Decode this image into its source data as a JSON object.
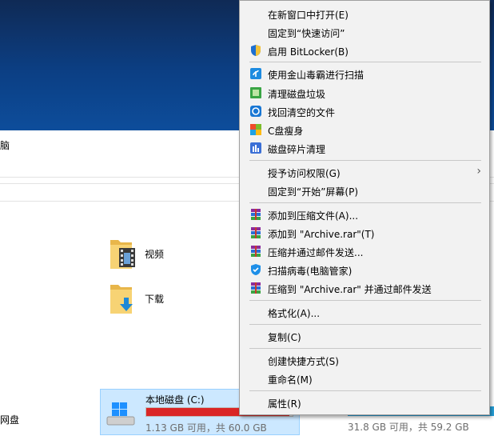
{
  "explorer": {
    "title_fragment": "脑",
    "folders": [
      {
        "label": "视频",
        "icon": "videos-folder-icon"
      },
      {
        "label": "下载",
        "icon": "downloads-folder-icon"
      }
    ],
    "drives": [
      {
        "name": "本地磁盘 (C:)",
        "free": "1.13 GB 可用，共 60.0 GB",
        "used_fraction": 0.98,
        "bar_color": "#da2626"
      },
      {
        "free": "31.8 GB 可用，共 59.2 GB",
        "bar_color": "#26a0da"
      }
    ],
    "netdisk_fragment": "网盘"
  },
  "menu": {
    "groups": [
      [
        {
          "label": "在新窗口中打开(E)"
        },
        {
          "label": "固定到“快速访问”"
        },
        {
          "label": "启用 BitLocker(B)",
          "icon": "shield-icon"
        }
      ],
      [
        {
          "label": "使用金山毒霸进行扫描",
          "icon": "kingsoft-antivirus-icon"
        },
        {
          "label": "清理磁盘垃圾",
          "icon": "disk-cleanup-icon"
        },
        {
          "label": "找回清空的文件",
          "icon": "file-recovery-icon"
        },
        {
          "label": "C盘瘦身",
          "icon": "c-drive-slim-icon"
        },
        {
          "label": "磁盘碎片清理",
          "icon": "defrag-icon"
        }
      ],
      [
        {
          "label": "授予访问权限(G)",
          "submenu": true
        },
        {
          "label": "固定到“开始”屏幕(P)"
        }
      ],
      [
        {
          "label": "添加到压缩文件(A)...",
          "icon": "winrar-icon"
        },
        {
          "label": "添加到 \"Archive.rar\"(T)",
          "icon": "winrar-icon"
        },
        {
          "label": "压缩并通过邮件发送...",
          "icon": "winrar-icon"
        },
        {
          "label": "扫描病毒(电脑管家)",
          "icon": "tencent-pc-manager-icon"
        },
        {
          "label": "压缩到 \"Archive.rar\" 并通过邮件发送",
          "icon": "winrar-icon"
        }
      ],
      [
        {
          "label": "格式化(A)..."
        }
      ],
      [
        {
          "label": "复制(C)"
        }
      ],
      [
        {
          "label": "创建快捷方式(S)"
        },
        {
          "label": "重命名(M)"
        }
      ],
      [
        {
          "label": "属性(R)"
        }
      ]
    ]
  }
}
